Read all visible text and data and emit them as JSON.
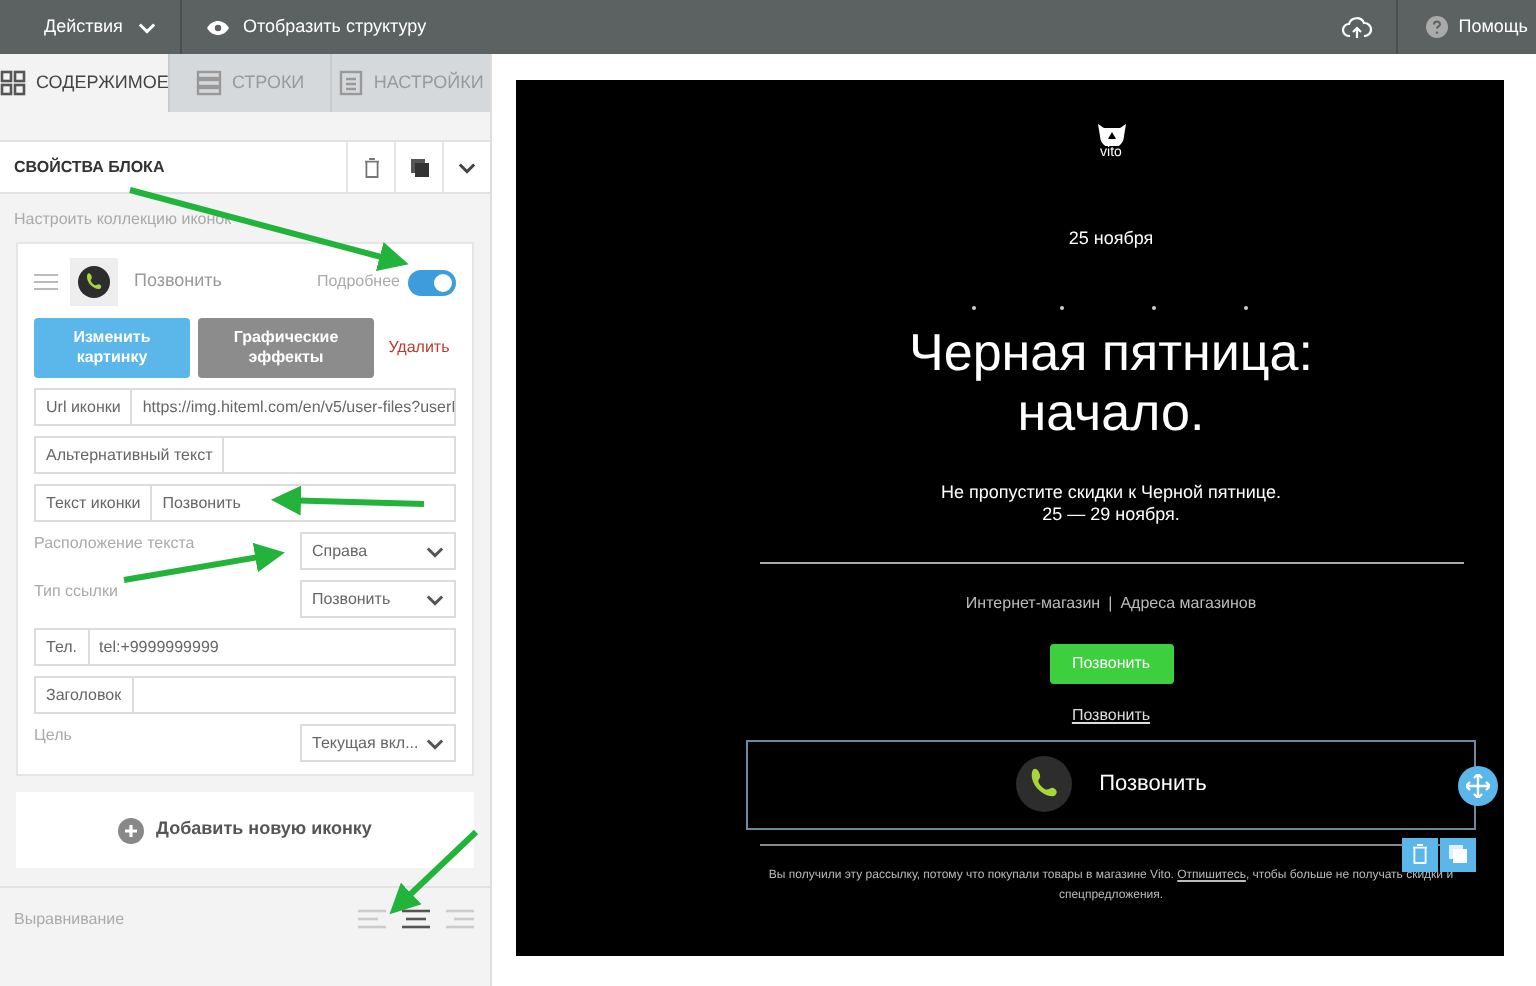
{
  "topbar": {
    "actions": "Действия",
    "structure": "Отобразить структуру",
    "help": "Помощь"
  },
  "tabs": [
    {
      "label": "СОДЕРЖИМОЕ",
      "kind": "content",
      "selected": true
    },
    {
      "label": "СТРОКИ",
      "kind": "rows",
      "selected": false
    },
    {
      "label": "НАСТРОЙКИ",
      "kind": "settings",
      "selected": false
    }
  ],
  "block_header": "СВОЙСТВА БЛОКА",
  "collection_label": "Настроить коллекцию иконок",
  "icon_item": {
    "name": "Позвонить",
    "details_label": "Подробнее",
    "details_on": true,
    "change_image": "Изменить картинку",
    "effects": "Графические эффекты",
    "delete": "Удалить"
  },
  "fields": [
    {
      "kind": "input",
      "label": "Url иконки",
      "value": "https://img.hiteml.com/en/v5/user-files?userI"
    },
    {
      "kind": "input",
      "label": "Альтернативный текст"
    },
    {
      "kind": "input",
      "label": "Текст иконки",
      "value": "Позвонить"
    },
    {
      "kind": "select",
      "label": "Расположение текста",
      "value": "Справа"
    },
    {
      "kind": "select",
      "label": "Тип ссылки",
      "value": "Позвонить"
    },
    {
      "kind": "input",
      "label": "Тел.",
      "value": "tel:+9999999999"
    },
    {
      "kind": "input",
      "label": "Заголовок"
    },
    {
      "kind": "select",
      "label": "Цель",
      "value": "Текущая вкл..."
    }
  ],
  "add_icon": "Добавить новую иконку",
  "alignment": {
    "label": "Выравнивание",
    "options": [
      {
        "kind": "left",
        "selected": false
      },
      {
        "kind": "center",
        "selected": true
      },
      {
        "kind": "right",
        "selected": false
      }
    ]
  },
  "email": {
    "logo_text": "vito",
    "date": "25 ноября",
    "headline_lines": [
      "Черная пятница:",
      "начало."
    ],
    "subtitle_lines": [
      "Не пропустите скидки к Черной пятнице.",
      "25 — 29 ноября."
    ],
    "links": [
      "Интернет-магазин",
      "Адреса магазинов"
    ],
    "link_separator": "|",
    "button": "Позвонить",
    "text_link": "Позвонить",
    "icon_block_text": "Позвонить",
    "footer": {
      "before": "Вы получили эту рассылку, потому что покупали товары в магазине Vito. ",
      "link": "Отпишитесь",
      "after": ", чтобы больше не получать скидки и спецпредложения."
    }
  }
}
